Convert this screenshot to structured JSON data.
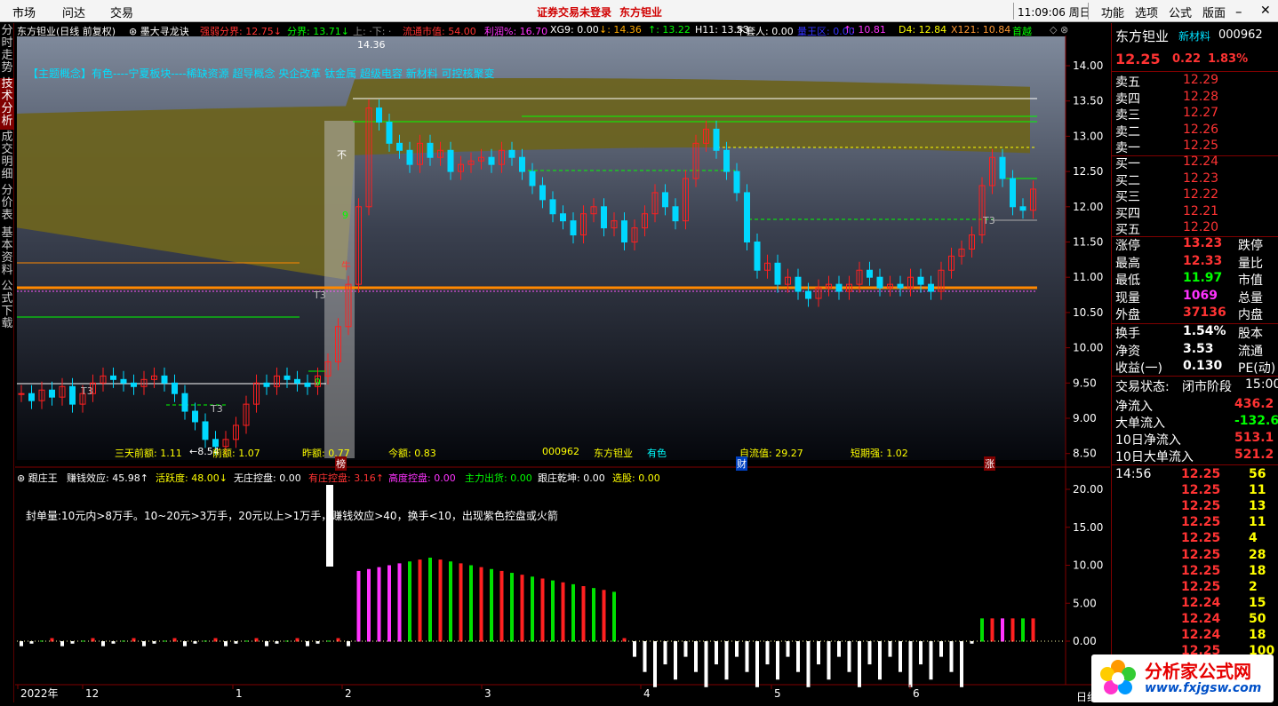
{
  "menubar": {
    "market": "市场",
    "wenda": "问达",
    "trade": "交易",
    "notice": "证券交易未登录",
    "stock_name": "东方钽业",
    "clock": "11:09:06 周日",
    "features": "功能",
    "select": "选项",
    "formula": "公式",
    "layout": "版面"
  },
  "lefttabs": [
    "分时走势",
    "技术分析",
    "成交明细",
    "分价表",
    "基本资料",
    "公式下载"
  ],
  "chart_header": {
    "title": "东方钽业(日线 前复权)",
    "indicator": "墨大寻龙诀",
    "items": [
      {
        "text": "强弱分界: 12.75↓",
        "color": "#ff3333"
      },
      {
        "text": "分界: 13.71↓",
        "color": "#00ff00"
      },
      {
        "text": "上: ·下: ·",
        "color": "#888888"
      },
      {
        "text": "流通市值: 54.00",
        "color": "#ff3333"
      },
      {
        "text": "利润%: 16.70",
        "color": "#ff33ff"
      },
      {
        "text": "XG9: 0.00",
        "color": "#ffffff"
      },
      {
        "text": "↓: 14.36",
        "color": "#ffaa00"
      },
      {
        "text": "↑: 13.22",
        "color": "#00ff00"
      },
      {
        "text": "H11: 13.53",
        "color": "#ffffff"
      },
      {
        "text": "不套人: 0.00",
        "color": "#ffffff"
      },
      {
        "text": "量王区: 0.00",
        "color": "#3333ff"
      },
      {
        "text": "↑: 10.81",
        "color": "#ff33ff"
      },
      {
        "text": "D4: 12.84",
        "color": "#ffff00"
      },
      {
        "text": "X121: 10.84",
        "color": "#ff9933"
      },
      {
        "text": "首越",
        "color": "#00ff00"
      }
    ],
    "concept": "【主题概念】有色----宁夏板块----稀缺资源 超导概念 央企改革 钛金属 超级电容 新材料 可控核聚变",
    "bottom_stats": [
      {
        "text": "三天前额: 1.11",
        "color": "#ffff00"
      },
      {
        "text": "前额: 1.07",
        "color": "#ffff00"
      },
      {
        "text": "昨额: 0.77",
        "color": "#ffff00"
      },
      {
        "text": "今额: 0.83",
        "color": "#ffff00"
      },
      {
        "text": "000962",
        "color": "#ffff00"
      },
      {
        "text": "东方钽业",
        "color": "#ffff00"
      },
      {
        "text": "有色",
        "color": "#00ffff"
      },
      {
        "text": "自流值: 29.27",
        "color": "#ffff00"
      },
      {
        "text": "短期强: 1.02",
        "color": "#ffff00"
      }
    ],
    "arrow_label": "←8.54",
    "top_label": "14.36",
    "markers": [
      "T3",
      "T3",
      "T3",
      "T3"
    ],
    "cn_labels": [
      "不",
      "牛",
      "9",
      "9",
      "T3"
    ],
    "badges": [
      "榜",
      "财",
      "涨"
    ]
  },
  "price_axis": [
    "14.00",
    "13.50",
    "13.00",
    "12.50",
    "12.00",
    "11.50",
    "11.00",
    "10.50",
    "10.00",
    "9.50",
    "9.00",
    "8.50"
  ],
  "sub_header": {
    "title": "跟庄王",
    "items": [
      {
        "text": "赚钱效应: 45.98↑",
        "color": "#ffffff"
      },
      {
        "text": "活跃度: 48.00↓",
        "color": "#ffff00"
      },
      {
        "text": "无庄控盘: 0.00",
        "color": "#ffffff"
      },
      {
        "text": "有庄控盘: 3.16↑",
        "color": "#ff3333"
      },
      {
        "text": "高度控盘: 0.00",
        "color": "#ff33ff"
      },
      {
        "text": "主力出货: 0.00",
        "color": "#00ff00"
      },
      {
        "text": "跟庄乾坤: 0.00",
        "color": "#ffffff"
      },
      {
        "text": "选股: 0.00",
        "color": "#ffff00"
      }
    ],
    "note": "封单量:10元内>8万手。10~20元>3万手，20元以上>1万手，赚钱效应>40，换手<10，出现紫色控盘或火箭"
  },
  "sub_axis": [
    "20.00",
    "15.00",
    "10.00",
    "5.00",
    "0.00"
  ],
  "date_axis": [
    "2022年",
    "12",
    "1",
    "2",
    "3",
    "4",
    "5",
    "6"
  ],
  "date_tab": "日线",
  "right_panel": {
    "name": "东方钽业",
    "tag": "新材料",
    "code": "000962",
    "price": "12.25",
    "change": "0.22",
    "pct": "1.83%",
    "asks": [
      {
        "label": "卖五",
        "price": "12.29"
      },
      {
        "label": "卖四",
        "price": "12.28"
      },
      {
        "label": "卖三",
        "price": "12.27"
      },
      {
        "label": "卖二",
        "price": "12.26"
      },
      {
        "label": "卖一",
        "price": "12.25"
      }
    ],
    "bids": [
      {
        "label": "买一",
        "price": "12.24"
      },
      {
        "label": "买二",
        "price": "12.23"
      },
      {
        "label": "买三",
        "price": "12.22"
      },
      {
        "label": "买四",
        "price": "12.21"
      },
      {
        "label": "买五",
        "price": "12.20"
      }
    ],
    "stats": [
      {
        "label": "涨停",
        "value": "13.23",
        "color": "#ff3333",
        "label2": "跌停"
      },
      {
        "label": "最高",
        "value": "12.33",
        "color": "#ff3333",
        "label2": "量比"
      },
      {
        "label": "最低",
        "value": "11.97",
        "color": "#00ff00",
        "label2": "市值"
      },
      {
        "label": "现量",
        "value": "1069",
        "color": "#ff33ff",
        "label2": "总量"
      },
      {
        "label": "外盘",
        "value": "37136",
        "color": "#ff3333",
        "label2": "内盘"
      }
    ],
    "stats2": [
      {
        "label": "换手",
        "value": "1.54%",
        "label2": "股本"
      },
      {
        "label": "净资",
        "value": "3.53",
        "label2": "流通"
      },
      {
        "label": "收益(一)",
        "value": "0.130",
        "label2": "PE(动)"
      }
    ],
    "trade_state_label": "交易状态:",
    "trade_state": "闭市阶段",
    "trade_time": "15:00",
    "flows": [
      {
        "label": "净流入",
        "value": "436.2",
        "color": "#ff3333"
      },
      {
        "label": "大单流入",
        "value": "-132.6",
        "color": "#00ff00"
      },
      {
        "label": "10日净流入",
        "value": "513.1",
        "color": "#ff3333"
      },
      {
        "label": "10日大单流入",
        "value": "521.2",
        "color": "#ff3333"
      }
    ],
    "ticks": [
      {
        "time": "14:56",
        "price": "12.25",
        "vol": "56",
        "pc": "#ff3333"
      },
      {
        "time": "",
        "price": "12.25",
        "vol": "11",
        "pc": "#ff3333"
      },
      {
        "time": "",
        "price": "12.25",
        "vol": "13",
        "pc": "#ff3333"
      },
      {
        "time": "",
        "price": "12.25",
        "vol": "11",
        "pc": "#ff3333"
      },
      {
        "time": "",
        "price": "12.25",
        "vol": "4",
        "pc": "#ff3333"
      },
      {
        "time": "",
        "price": "12.25",
        "vol": "28",
        "pc": "#ff3333"
      },
      {
        "time": "",
        "price": "12.25",
        "vol": "18",
        "pc": "#ff3333"
      },
      {
        "time": "",
        "price": "12.25",
        "vol": "2",
        "pc": "#ff3333"
      },
      {
        "time": "",
        "price": "12.24",
        "vol": "15",
        "pc": "#ff3333"
      },
      {
        "time": "",
        "price": "12.24",
        "vol": "50",
        "pc": "#ff3333"
      },
      {
        "time": "",
        "price": "12.24",
        "vol": "18",
        "pc": "#ff3333"
      },
      {
        "time": "",
        "price": "12.25",
        "vol": "100",
        "pc": "#ff3333"
      }
    ]
  },
  "logo": {
    "title": "分析家公式网",
    "url": "www.fxjgsw.com"
  },
  "colors": {
    "up": "#ff2020",
    "down": "#00d8ff",
    "band": "#6b6320",
    "accent": "#800000"
  }
}
